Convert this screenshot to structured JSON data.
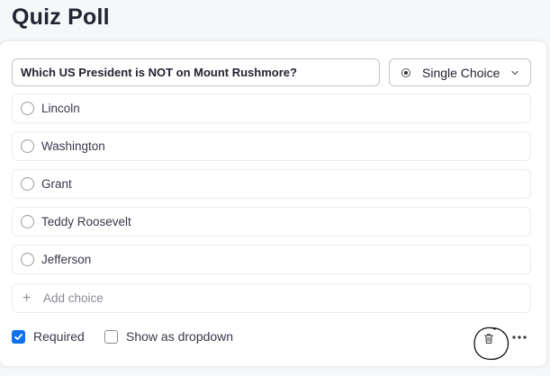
{
  "page": {
    "title": "Quiz Poll"
  },
  "question": {
    "value": "Which US President is NOT on Mount Rushmore?",
    "type_label": "Single Choice"
  },
  "choices": [
    {
      "label": "Lincoln"
    },
    {
      "label": "Washington"
    },
    {
      "label": "Grant"
    },
    {
      "label": "Teddy Roosevelt"
    },
    {
      "label": "Jefferson"
    }
  ],
  "add_choice": {
    "label": "Add choice",
    "icon": "plus-icon"
  },
  "footer": {
    "required_label": "Required",
    "required_checked": true,
    "dropdown_label": "Show as dropdown",
    "dropdown_checked": false,
    "delete_icon": "trash-icon",
    "more_icon": "more-icon"
  },
  "colors": {
    "accent": "#0e72ed",
    "text": "#232333",
    "border": "#c4c6cc"
  }
}
